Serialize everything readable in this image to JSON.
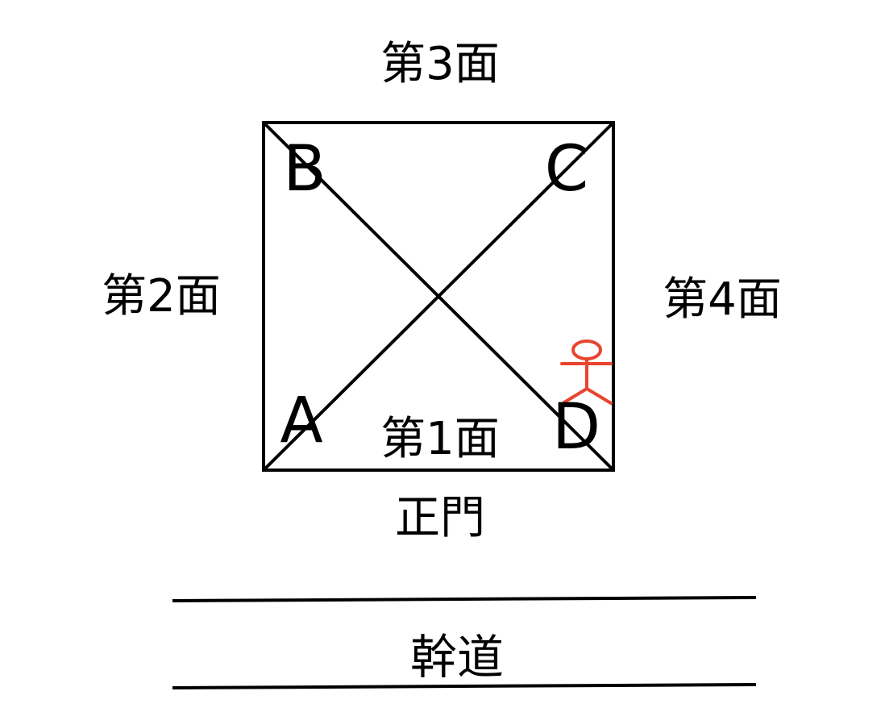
{
  "faces": {
    "front": "第1面",
    "left": "第2面",
    "back": "第3面",
    "right": "第4面"
  },
  "corners": {
    "a": "A",
    "b": "B",
    "c": "C",
    "d": "D"
  },
  "gate_label": "正門",
  "road_label": "幹道",
  "colors": {
    "lines": "#000000",
    "person": "#e8442e"
  },
  "icons": {
    "person": "person-icon"
  }
}
